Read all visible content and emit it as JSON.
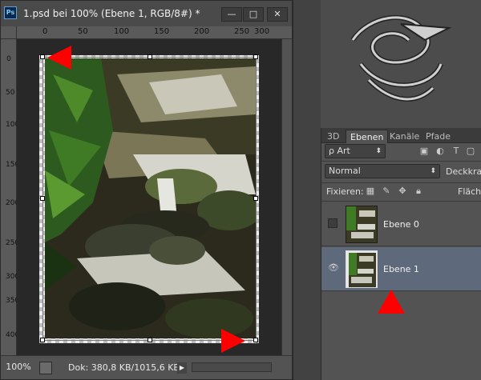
{
  "window": {
    "title": "1.psd bei 100% (Ebene 1, RGB/8#) *",
    "app_icon": "Ps",
    "buttons": {
      "minimize": "—",
      "maximize": "□",
      "close": "✕"
    }
  },
  "ruler": {
    "horizontal": [
      "0",
      "50",
      "100",
      "150",
      "200",
      "250",
      "300"
    ],
    "vertical": [
      "0",
      "50",
      "100",
      "150",
      "200",
      "250",
      "300",
      "350",
      "400"
    ]
  },
  "status": {
    "zoom": "100%",
    "doc_info": "Dok: 380,8 KB/1015,6 KB",
    "arrow": "▶"
  },
  "layers_panel": {
    "tabs": [
      "3D",
      "Ebenen",
      "Kanäle",
      "Pfade"
    ],
    "active_tab": "Ebenen",
    "filter": "ρ Art",
    "blend_mode": "Normal",
    "opacity_label": "Deckkraft",
    "lock_label": "Fixieren:",
    "fill_label": "Fläche",
    "layers": [
      {
        "name": "Ebene 0",
        "visible": false,
        "selected": false
      },
      {
        "name": "Ebene 1",
        "visible": true,
        "selected": true
      }
    ]
  },
  "annotations": {
    "marker_color": "#ff0000"
  },
  "colors": {
    "selection": "#5e6a7c",
    "marker": "#ff0000"
  }
}
